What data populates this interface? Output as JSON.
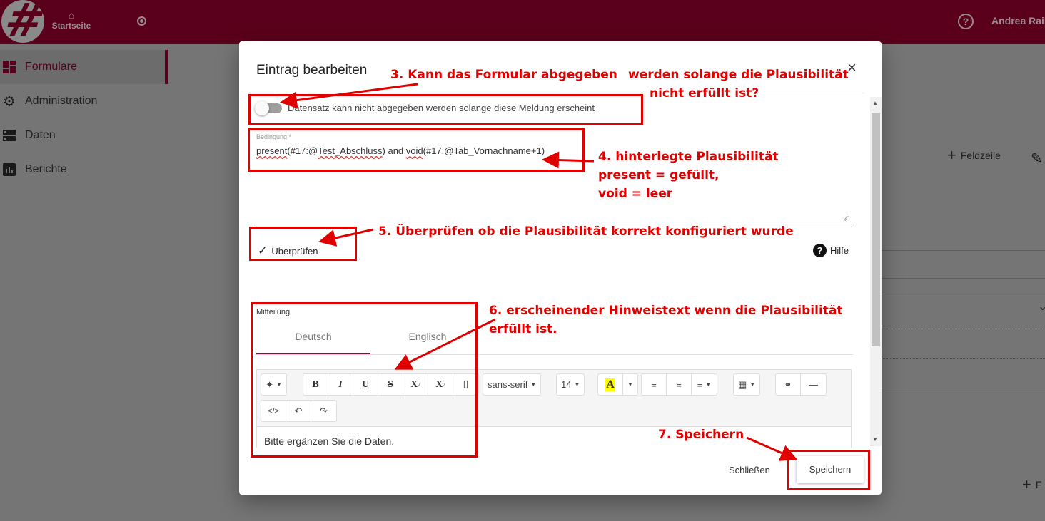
{
  "topbar": {
    "logo_glyph": "#",
    "home_label": "Startseite",
    "user_name": "Andrea Raile",
    "help_glyph": "?"
  },
  "sidebar": {
    "items": [
      {
        "label": "Formulare",
        "icon": "dashboard-icon",
        "active": true
      },
      {
        "label": "Administration",
        "icon": "gear-icon",
        "active": false
      },
      {
        "label": "Daten",
        "icon": "storage-icon",
        "active": false
      },
      {
        "label": "Berichte",
        "icon": "bar-chart-icon",
        "active": false
      }
    ]
  },
  "background": {
    "add_field_row_label": "Feldzeile",
    "add_bottom_label": "F"
  },
  "dialog": {
    "title": "Eintrag bearbeiten",
    "close_glyph": "×",
    "toggle_label": "Datensatz kann nicht abgegeben werden solange diese Meldung erscheint",
    "toggle_on": false,
    "condition_label": "Bedingung *",
    "condition_parts": {
      "p1": "present",
      "p2": "(#17:@",
      "p3": "Test_Abschluss",
      "p4": ") and ",
      "p5": "void",
      "p6": "(#17:@Tab_Vornachname+1)"
    },
    "check_label": "Überprüfen",
    "help_label": "Hilfe",
    "message_label": "Mitteilung",
    "tabs": [
      {
        "label": "Deutsch",
        "active": true
      },
      {
        "label": "Englisch",
        "active": false
      }
    ],
    "editor": {
      "font_family": "sans-serif",
      "font_size": "14",
      "content": "Bitte ergänzen Sie die Daten."
    },
    "close_button": "Schließen",
    "save_button": "Speichern"
  },
  "annotations": {
    "a3_line1": "3. Kann das Formular abgegeben",
    "a3_line1b": "werden solange die Plausibilität",
    "a3_line2": "nicht erfüllt ist?",
    "a4_line1": "4. hinterlegte Plausibilität",
    "a4_line2": "present = gefüllt,",
    "a4_line3": "void = leer",
    "a5": "5. Überprüfen ob die Plausibilität korrekt konfiguriert wurde",
    "a6_line1": "6. erscheinender Hinweistext wenn die Plausibilität",
    "a6_line2": "erfüllt ist.",
    "a7": "7. Speichern",
    "color": "#e00000"
  }
}
